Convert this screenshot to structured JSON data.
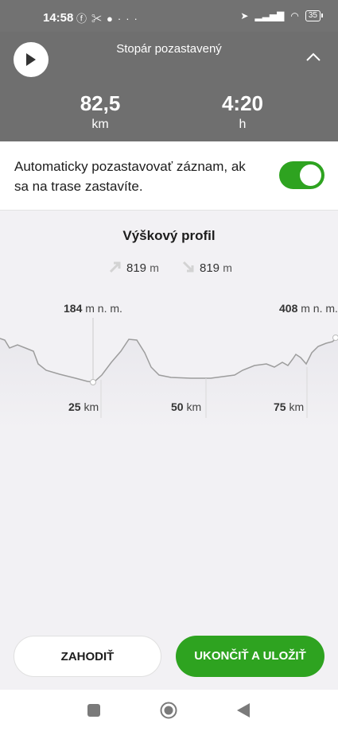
{
  "status_bar": {
    "time": "14:58",
    "left_icons": [
      "facebook-icon",
      "fitness-icon",
      "chat-icon",
      "more-dots"
    ],
    "battery": "35"
  },
  "header": {
    "title": "Stopár pozastavený",
    "distance": {
      "value": "82,5",
      "unit": "km"
    },
    "duration": {
      "value": "4:20",
      "unit": "h"
    }
  },
  "settings": {
    "auto_pause_label": "Automaticky pozastavovať záznam, ak sa na trase zastavíte.",
    "auto_pause_on": true
  },
  "profile": {
    "title": "Výškový profil",
    "ascent": {
      "value": "819",
      "unit": "m"
    },
    "descent": {
      "value": "819",
      "unit": "m"
    },
    "min_elevation": {
      "value": "184",
      "unit": "m n. m."
    },
    "max_elevation": {
      "value": "408",
      "unit": "m n. m."
    },
    "km_marks": [
      {
        "value": "25",
        "unit": "km"
      },
      {
        "value": "50",
        "unit": "km"
      },
      {
        "value": "75",
        "unit": "km"
      }
    ]
  },
  "buttons": {
    "discard": "ZAHODIŤ",
    "finish_save": "UKONČIŤ A ULOŽIŤ"
  },
  "colors": {
    "accent_green": "#2ea320",
    "header_gray": "#6f6f6f"
  }
}
